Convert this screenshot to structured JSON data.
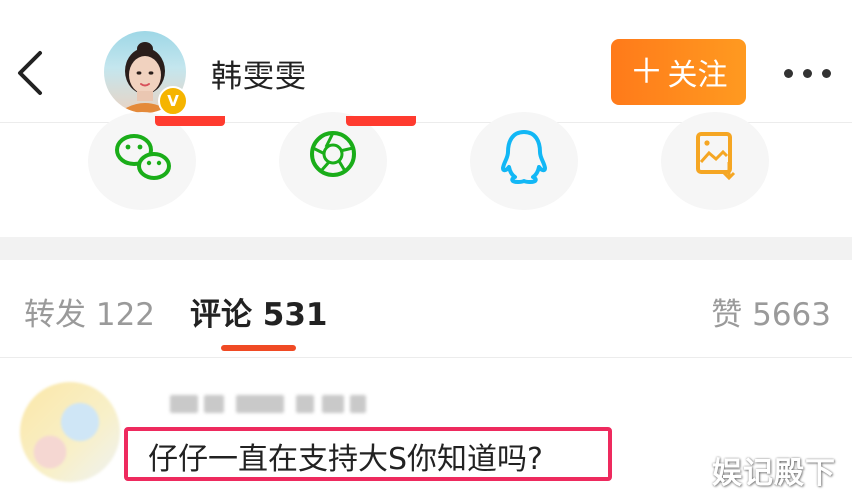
{
  "header": {
    "username": "韩雯雯",
    "verified_badge": "V",
    "follow_label": "关注",
    "follow_prefix": "＋",
    "icons": [
      "back-icon",
      "more-icon"
    ]
  },
  "share": {
    "items": [
      {
        "name": "wechat",
        "icon": "wechat-icon",
        "color": "#1aad19",
        "has_badge": true
      },
      {
        "name": "moments",
        "icon": "moments-icon",
        "color": "#1aad19",
        "has_badge": true
      },
      {
        "name": "qq",
        "icon": "qq-icon",
        "color": "#12b7f5",
        "has_badge": false
      },
      {
        "name": "save-image",
        "icon": "save-image-icon",
        "color": "#f5a623",
        "has_badge": false
      }
    ]
  },
  "tabs": {
    "repost": {
      "label": "转发",
      "count": "122"
    },
    "comment": {
      "label": "评论",
      "count": "531"
    },
    "like": {
      "label": "赞",
      "count": "5663"
    }
  },
  "comment": {
    "text": "仔仔一直在支持大S你知道吗?"
  },
  "watermark": "娱记殿下",
  "colors": {
    "accent_orange": "#ff8a1e",
    "tab_underline": "#f04a24",
    "highlight_border": "#ee2a5e"
  }
}
